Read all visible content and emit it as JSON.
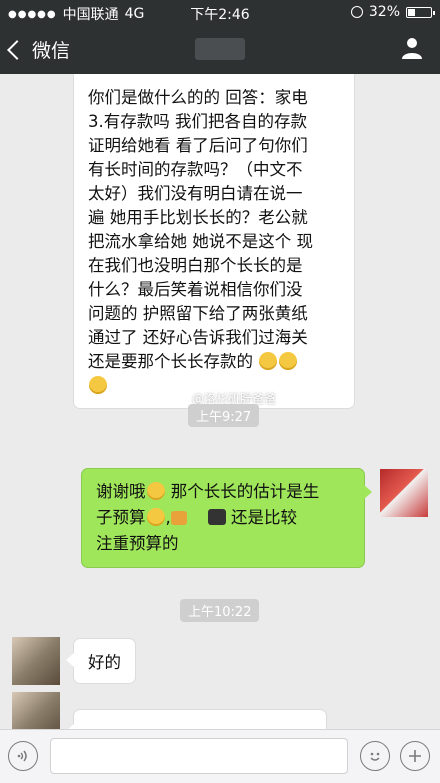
{
  "status_bar": {
    "signal_dots": "●●●●●",
    "carrier": "中国联通",
    "network": "4G",
    "time": "下午2:46",
    "battery": "32%",
    "battery_level": 0.32
  },
  "nav": {
    "back_label": "微信",
    "title": ""
  },
  "messages": {
    "long_text_lines": [
      "你们是做什么的的 回答：家电",
      "3.有存款吗 我们把各自的存款",
      "证明给她看  看了后问了句你们",
      "有长时间的存款吗？（中文不",
      "太好）我们没有明白请在说一",
      "遍 她用手比划长长的？老公就",
      "把流水拿给她 她说不是这个 现",
      "在我们也没明白那个长长的是",
      "什么？最后笑着说相信你们没",
      "问题的 护照留下给了两张黄纸",
      "通过了 还好心告诉我们过海关",
      "还是要那个长长存款的"
    ],
    "watermark": "@洛杉矶胖爸爸",
    "time_1": "上午9:27",
    "reply_part1": "谢谢哦",
    "reply_part2": "那个长长的估计是生",
    "reply_part3": "子预算",
    "reply_part4": "还是比较",
    "reply_part5": "注重预算的",
    "time_2": "上午10:22",
    "short_reply": "好的"
  },
  "input": {
    "voice_icon": "voice-icon",
    "emoji_icon": "emoji-icon",
    "plus_icon": "plus-icon"
  }
}
